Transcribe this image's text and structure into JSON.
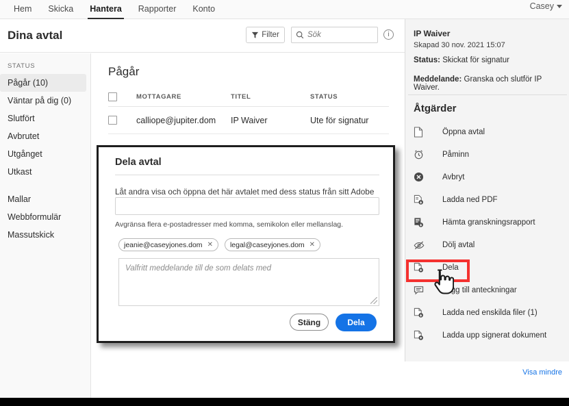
{
  "topnav": {
    "tabs": [
      {
        "label": "Hem",
        "active": false
      },
      {
        "label": "Skicka",
        "active": false
      },
      {
        "label": "Hantera",
        "active": true
      },
      {
        "label": "Rapporter",
        "active": false
      },
      {
        "label": "Konto",
        "active": false
      }
    ],
    "user": "Casey"
  },
  "header": {
    "title": "Dina avtal",
    "filter_label": "Filter",
    "search_placeholder": "Sök",
    "search_value": "",
    "info_glyph": "i"
  },
  "sidebar": {
    "group_label": "STATUS",
    "items": [
      {
        "label": "Pågår (10)",
        "active": true
      },
      {
        "label": "Väntar på dig (0)",
        "active": false
      },
      {
        "label": "Slutfört",
        "active": false
      },
      {
        "label": "Avbrutet",
        "active": false
      },
      {
        "label": "Utgånget",
        "active": false
      },
      {
        "label": "Utkast",
        "active": false
      }
    ],
    "items2": [
      {
        "label": "Mallar"
      },
      {
        "label": "Webbformulär"
      },
      {
        "label": "Massutskick"
      }
    ]
  },
  "main": {
    "section_title": "Pågår",
    "columns": [
      "MOTTAGARE",
      "TITEL",
      "STATUS"
    ],
    "rows": [
      {
        "recipient": "calliope@jupiter.dom",
        "title": "IP Waiver",
        "status": "Ute för signatur"
      }
    ]
  },
  "dialog": {
    "title": "Dela avtal",
    "description": "Låt andra visa och öppna det här avtalet med dess status från sitt Adobe Sign-konto.",
    "email_value": "",
    "hint": "Avgränsa flera e-postadresser med komma, semikolon eller mellanslag.",
    "chips": [
      {
        "email": "jeanie@caseyjones.dom",
        "remove": "✕"
      },
      {
        "email": "legal@caseyjones.dom",
        "remove": "✕"
      }
    ],
    "message_placeholder": "Valfritt meddelande till de som delats med",
    "message_value": "",
    "close_label": "Stäng",
    "share_label": "Dela"
  },
  "right_panel": {
    "doc_title": "IP Waiver",
    "created": "Skapad 30 nov. 2021 15:07",
    "status_label": "Status:",
    "status_value": "Skickat för signatur",
    "message_label": "Meddelande:",
    "message_value": "Granska och slutför IP Waiver.",
    "actions_title": "Åtgärder",
    "actions": [
      {
        "label": "Öppna avtal",
        "icon": "document-icon"
      },
      {
        "label": "Påminn",
        "icon": "alarm-clock-icon"
      },
      {
        "label": "Avbryt",
        "icon": "cancel-circle-icon"
      },
      {
        "label": "Ladda ned PDF",
        "icon": "download-pdf-icon"
      },
      {
        "label": "Hämta granskningsrapport",
        "icon": "audit-report-icon"
      },
      {
        "label": "Dölj avtal",
        "icon": "eye-off-icon"
      },
      {
        "label": "Dela",
        "icon": "share-document-icon",
        "highlighted": true
      },
      {
        "label": "Lägg till anteckningar",
        "icon": "comment-icon"
      },
      {
        "label": "Ladda ned enskilda filer (1)",
        "icon": "download-files-icon"
      },
      {
        "label": "Ladda upp signerat dokument",
        "icon": "upload-document-icon"
      }
    ],
    "show_less": "Visa mindre"
  },
  "colors": {
    "accent_blue": "#1473E6",
    "highlight_red": "#F4312F",
    "panel_bg": "#F4F4F4",
    "sidebar_bg": "#F9F9F9"
  }
}
